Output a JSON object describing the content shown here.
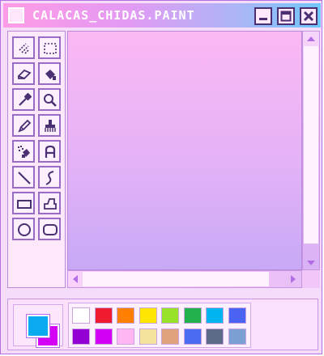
{
  "window": {
    "title": "CALACAS_CHIDAS.PAINT",
    "buttons": [
      "minimize",
      "maximize",
      "close"
    ]
  },
  "toolbox": {
    "tools": [
      {
        "name": "free-select",
        "icon": "lasso-icon"
      },
      {
        "name": "rect-select",
        "icon": "dotted-rect-icon"
      },
      {
        "name": "eraser",
        "icon": "eraser-icon"
      },
      {
        "name": "fill",
        "icon": "paint-bucket-icon"
      },
      {
        "name": "pick-color",
        "icon": "eyedropper-icon"
      },
      {
        "name": "magnifier",
        "icon": "magnifier-icon"
      },
      {
        "name": "pencil",
        "icon": "pencil-icon"
      },
      {
        "name": "brush",
        "icon": "brush-icon"
      },
      {
        "name": "airbrush",
        "icon": "airbrush-icon"
      },
      {
        "name": "text",
        "icon": "text-a-icon"
      },
      {
        "name": "line",
        "icon": "line-icon"
      },
      {
        "name": "curve",
        "icon": "curve-icon"
      },
      {
        "name": "rectangle",
        "icon": "rectangle-icon"
      },
      {
        "name": "polygon",
        "icon": "polygon-icon"
      },
      {
        "name": "ellipse",
        "icon": "ellipse-icon"
      },
      {
        "name": "rounded-rectangle",
        "icon": "rounded-rect-icon"
      }
    ]
  },
  "colors": {
    "foreground": "#0aaaf0",
    "background": "#d400f5",
    "palette": [
      "#ffffff",
      "#ee1c2e",
      "#ff7f00",
      "#ffe600",
      "#99e22a",
      "#22b14c",
      "#00b4f0",
      "#4a63f3",
      "#9400d3",
      "#d400f5",
      "#ffb6f2",
      "#f3e39c",
      "#e0a27c",
      "#4a6cf3",
      "#5a6a87",
      "#7c9fd3"
    ]
  }
}
